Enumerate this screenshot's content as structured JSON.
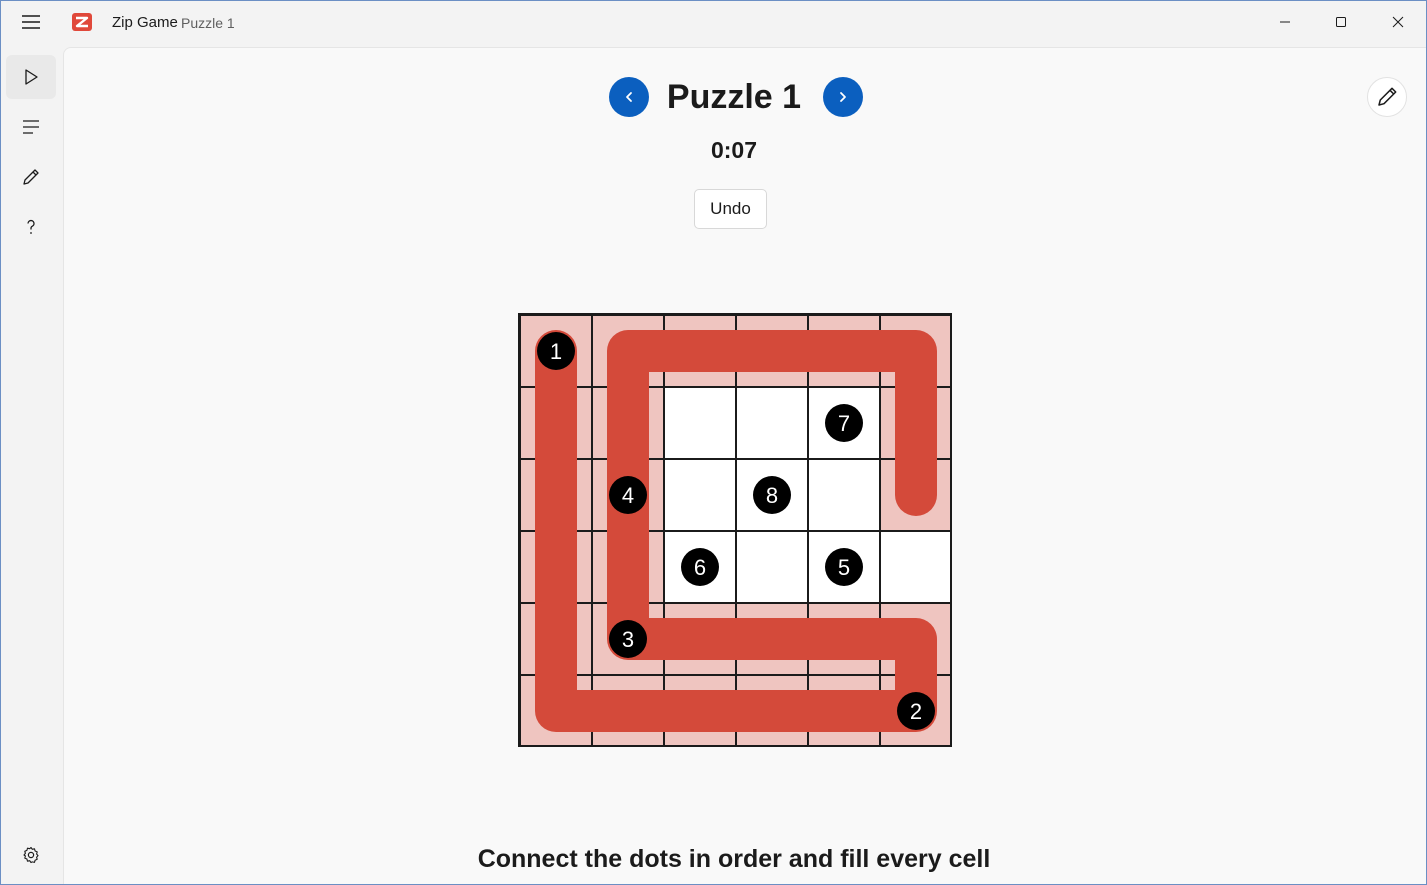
{
  "app": {
    "name": "Zip Game",
    "subtitle": "Puzzle 1"
  },
  "window_controls": [
    "minimize-icon",
    "maximize-icon",
    "close-icon"
  ],
  "nav_rail": {
    "items": [
      {
        "icon": "play-icon",
        "active": true
      },
      {
        "icon": "list-icon",
        "active": false
      },
      {
        "icon": "pencil-icon",
        "active": false
      },
      {
        "icon": "help-icon",
        "active": false
      }
    ],
    "footer_icon": "settings-icon"
  },
  "puzzle": {
    "title": "Puzzle 1",
    "timer": "0:07",
    "undo_label": "Undo",
    "instruction": "Connect the dots in order and fill every cell"
  },
  "colors": {
    "accent": "#0b5fbf",
    "path": "#d44a3a",
    "filled_cell": "#efc5c0",
    "dot": "#000000"
  },
  "grid": {
    "rows": 6,
    "cols": 6,
    "dots": [
      {
        "n": "1",
        "row": 0,
        "col": 0
      },
      {
        "n": "2",
        "row": 5,
        "col": 5
      },
      {
        "n": "3",
        "row": 4,
        "col": 1
      },
      {
        "n": "4",
        "row": 2,
        "col": 1
      },
      {
        "n": "5",
        "row": 3,
        "col": 4
      },
      {
        "n": "6",
        "row": 3,
        "col": 2
      },
      {
        "n": "7",
        "row": 1,
        "col": 4
      },
      {
        "n": "8",
        "row": 2,
        "col": 3
      }
    ],
    "path": [
      [
        0,
        0
      ],
      [
        1,
        0
      ],
      [
        2,
        0
      ],
      [
        3,
        0
      ],
      [
        4,
        0
      ],
      [
        5,
        0
      ],
      [
        5,
        1
      ],
      [
        5,
        2
      ],
      [
        5,
        3
      ],
      [
        5,
        4
      ],
      [
        5,
        5
      ],
      [
        4,
        5
      ],
      [
        4,
        4
      ],
      [
        4,
        3
      ],
      [
        4,
        2
      ],
      [
        4,
        1
      ],
      [
        3,
        1
      ],
      [
        2,
        1
      ],
      [
        1,
        1
      ],
      [
        0,
        1
      ],
      [
        0,
        2
      ],
      [
        0,
        3
      ],
      [
        0,
        4
      ],
      [
        0,
        5
      ],
      [
        1,
        5
      ],
      [
        2,
        5
      ]
    ]
  }
}
